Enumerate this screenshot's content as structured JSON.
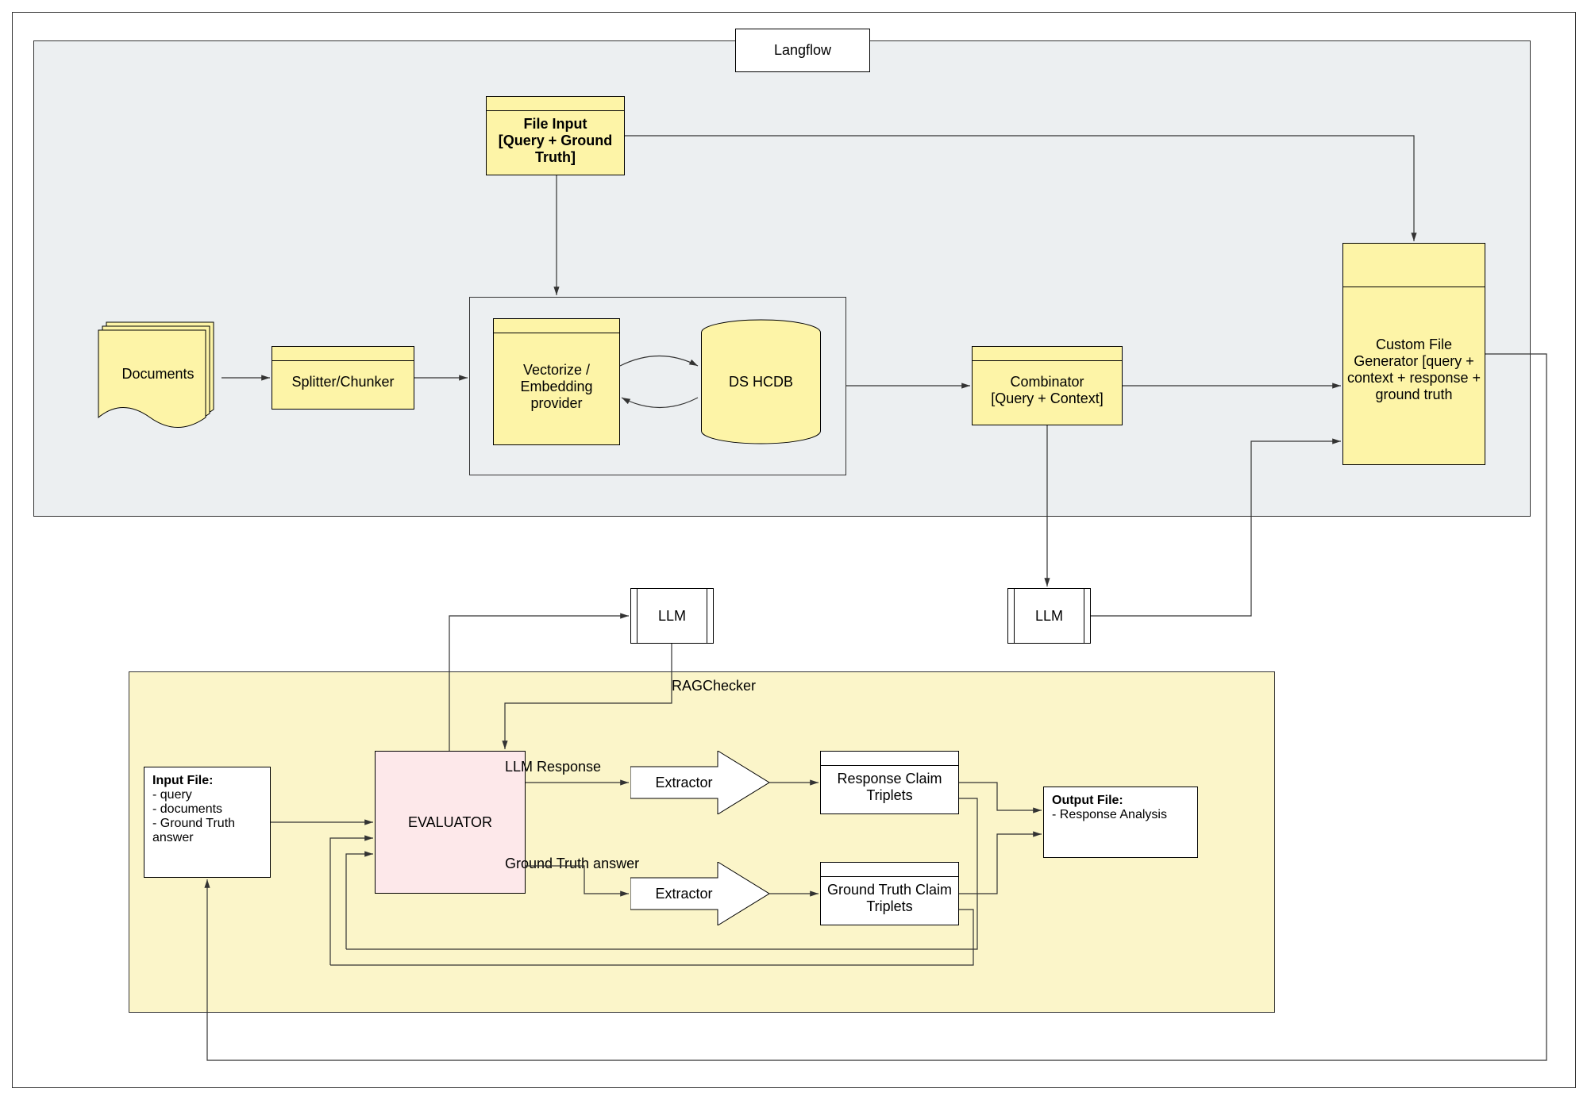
{
  "container_labels": {
    "langflow": "Langflow",
    "ragchecker": "RAGChecker"
  },
  "nodes": {
    "documents": "Documents",
    "splitter": "Splitter/Chunker",
    "file_input": "File Input\n[Query + Ground Truth]",
    "vectorize": "Vectorize / Embedding provider",
    "dshcdb": "DS HCDB",
    "combinator": "Combinator\n[Query + Context]",
    "custom_file_gen": "Custom File Generator [query + context + response + ground truth",
    "llm1": "LLM",
    "llm2": "LLM",
    "input_file_title": "Input File:",
    "input_file_body": "  - query\n  - documents\n  - Ground Truth answer",
    "evaluator": "EVALUATOR",
    "extractor1": "Extractor",
    "extractor2": "Extractor",
    "resp_triplets": "Response Claim Triplets",
    "gt_triplets": "Ground Truth Claim Triplets",
    "output_file_title": "Output File:",
    "output_file_body": "- Response Analysis"
  },
  "edge_labels": {
    "llm_response": "LLM Response",
    "gt_answer": "Ground Truth answer"
  }
}
